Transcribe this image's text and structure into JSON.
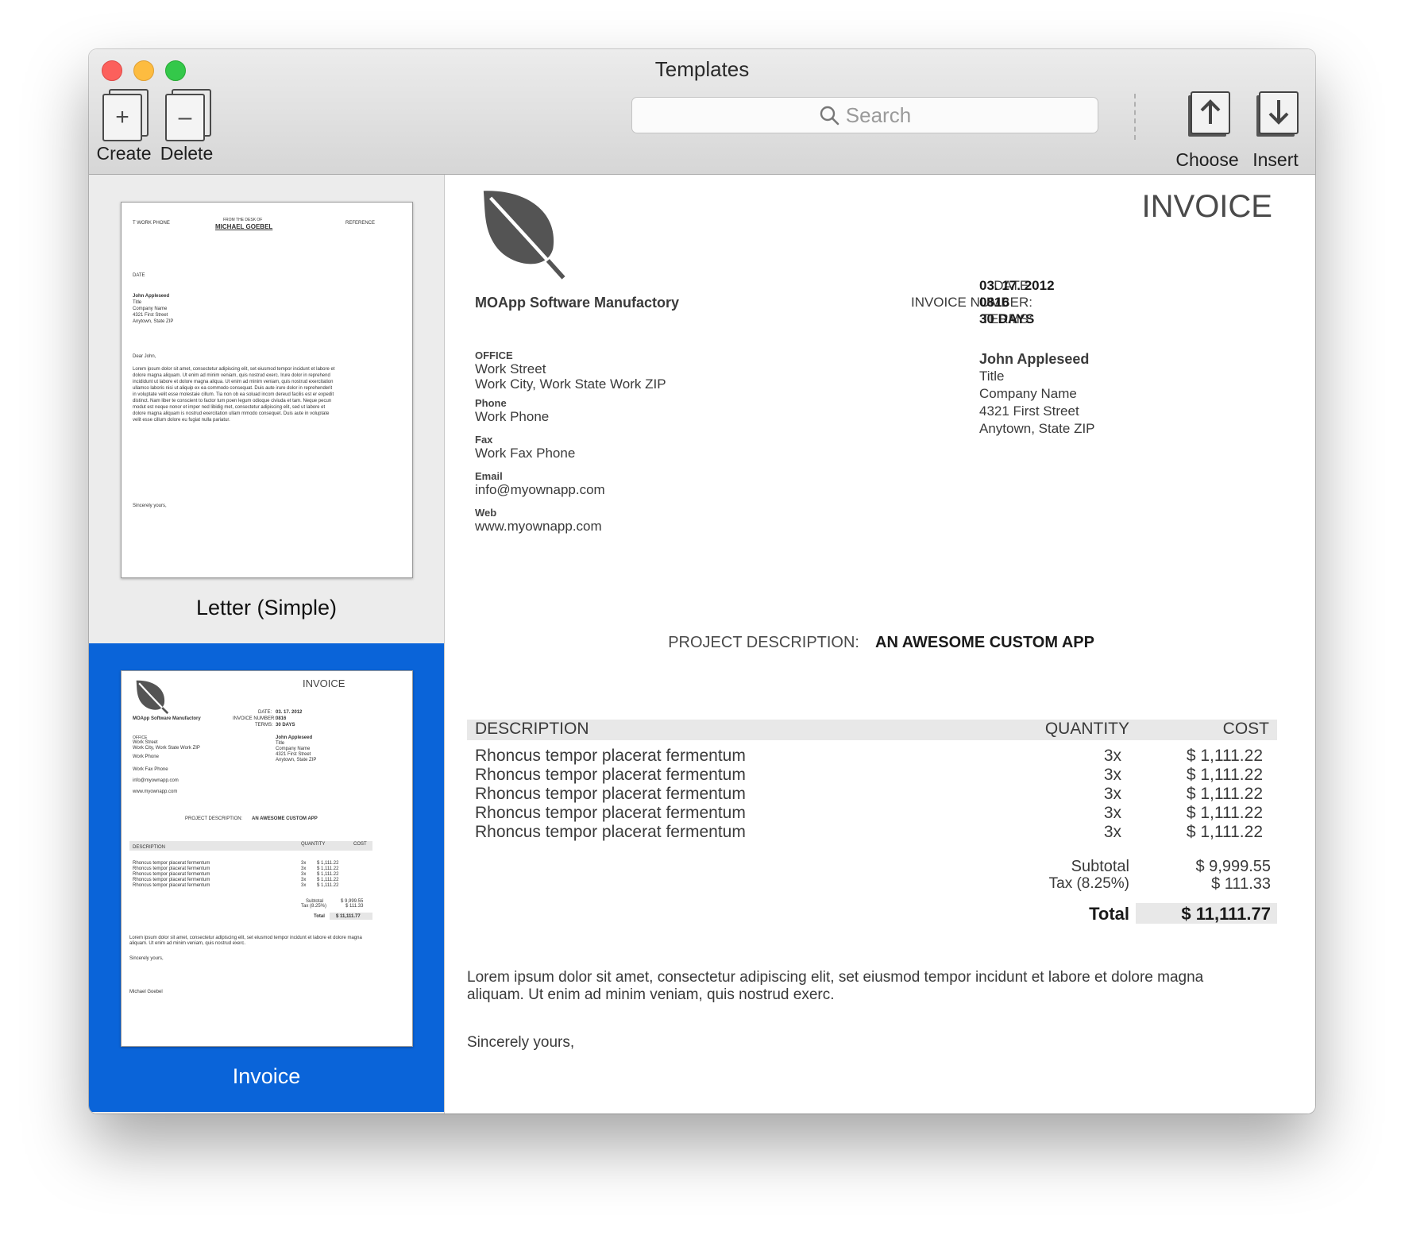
{
  "window": {
    "title": "Templates"
  },
  "toolbar": {
    "create_label": "Create",
    "delete_label": "Delete",
    "search_placeholder": "Search",
    "choose_label": "Choose",
    "insert_label": "Insert"
  },
  "templates": [
    {
      "label": "Letter (Simple)"
    },
    {
      "label": "Invoice"
    }
  ],
  "letter_thumb": {
    "work_phone": "T WORK PHONE",
    "from_desk": "FROM THE DESK OF",
    "name": "MICHAEL GOEBEL",
    "reference": "REFERENCE",
    "date": "DATE",
    "recipient": [
      "John Appleseed",
      "Title",
      "Company Name",
      "4321 First Street",
      "Anytown, State ZIP"
    ],
    "greeting": "Dear John,",
    "body": [
      "Lorem ipsum dolor sit amet, consectetur adipiscing elit, set eiusmod tempor incidunt et labore et",
      "dolore magna aliquam. Ut enim ad minim veniam, quis nostrud exerc. Irure dolor in reprehend",
      "incididunt ut labore et dolore magna aliqua. Ut enim ad minim veniam, quis nostrud exercitation",
      "ullamco laboris nisi ut aliquip ex ea commodo consequat. Duis aute irure dolor in reprehenderit",
      "in voluptate velit esse molestaie cillum. Tia non ob ea soluad incom dereud facilis est er expedit",
      "distinct. Nam liber te conscient to factor tum poen legum odioque civiuda et tam. Neque pecun",
      "modut est neque nonor et imper ned libidig met, consectetur adipiscing elit, sed ut labore et",
      "dolore magna aliquam is nostrud exercitation ullam mmodo consequet. Duis aute in voluptate",
      "velit esse cillum dolore eu fugiat nulla pariatur."
    ],
    "closing": "Sincerely yours,"
  },
  "invoice_thumb": {
    "signature": "Michael Goebel"
  },
  "invoice": {
    "heading": "INVOICE",
    "company": "MOApp Software Manufactory",
    "date_label": "DATE:",
    "date_value": "03. 17. 2012",
    "number_label": "INVOICE NUMBER:",
    "number_value": "0816",
    "terms_label": "TERMS:",
    "terms_value": "30 DAYS",
    "office_label": "OFFICE",
    "office_street": "Work Street",
    "office_city": "Work City, Work State Work ZIP",
    "phone_label": "Phone",
    "phone_value": "Work Phone",
    "fax_label": "Fax",
    "fax_value": "Work Fax Phone",
    "email_label": "Email",
    "email_value": "info@myownapp.com",
    "web_label": "Web",
    "web_value": "www.myownapp.com",
    "client_name": "John Appleseed",
    "client_title": "Title",
    "client_company": "Company Name",
    "client_street": "4321 First Street",
    "client_city": "Anytown, State ZIP",
    "project_label": "PROJECT DESCRIPTION:",
    "project_value": "AN AWESOME CUSTOM APP",
    "col_description": "DESCRIPTION",
    "col_quantity": "QUANTITY",
    "col_cost": "COST",
    "items": [
      {
        "description": "Rhoncus tempor placerat fermentum",
        "quantity": "3x",
        "cost": "$ 1,111.22"
      },
      {
        "description": "Rhoncus tempor placerat fermentum",
        "quantity": "3x",
        "cost": "$ 1,111.22"
      },
      {
        "description": "Rhoncus tempor placerat fermentum",
        "quantity": "3x",
        "cost": "$ 1,111.22"
      },
      {
        "description": "Rhoncus tempor placerat fermentum",
        "quantity": "3x",
        "cost": "$ 1,111.22"
      },
      {
        "description": "Rhoncus tempor placerat fermentum",
        "quantity": "3x",
        "cost": "$ 1,111.22"
      }
    ],
    "subtotal_label": "Subtotal",
    "subtotal_value": "$ 9,999.55",
    "tax_label": "Tax (8.25%)",
    "tax_value": "$ 111.33",
    "total_label": "Total",
    "total_value": "$ 11,111.77",
    "body_line1": "Lorem ipsum dolor sit amet, consectetur adipiscing elit, set eiusmod tempor incidunt et labore et dolore magna",
    "body_line2": "aliquam. Ut enim ad minim veniam, quis nostrud exerc.",
    "closing": "Sincerely yours,"
  },
  "colors": {
    "selection": "#0a64d9",
    "logo": "#545454"
  },
  "icons": [
    "create-doc-icon",
    "delete-doc-icon",
    "search-icon",
    "choose-upload-icon",
    "insert-download-icon",
    "leaf-logo-icon"
  ]
}
